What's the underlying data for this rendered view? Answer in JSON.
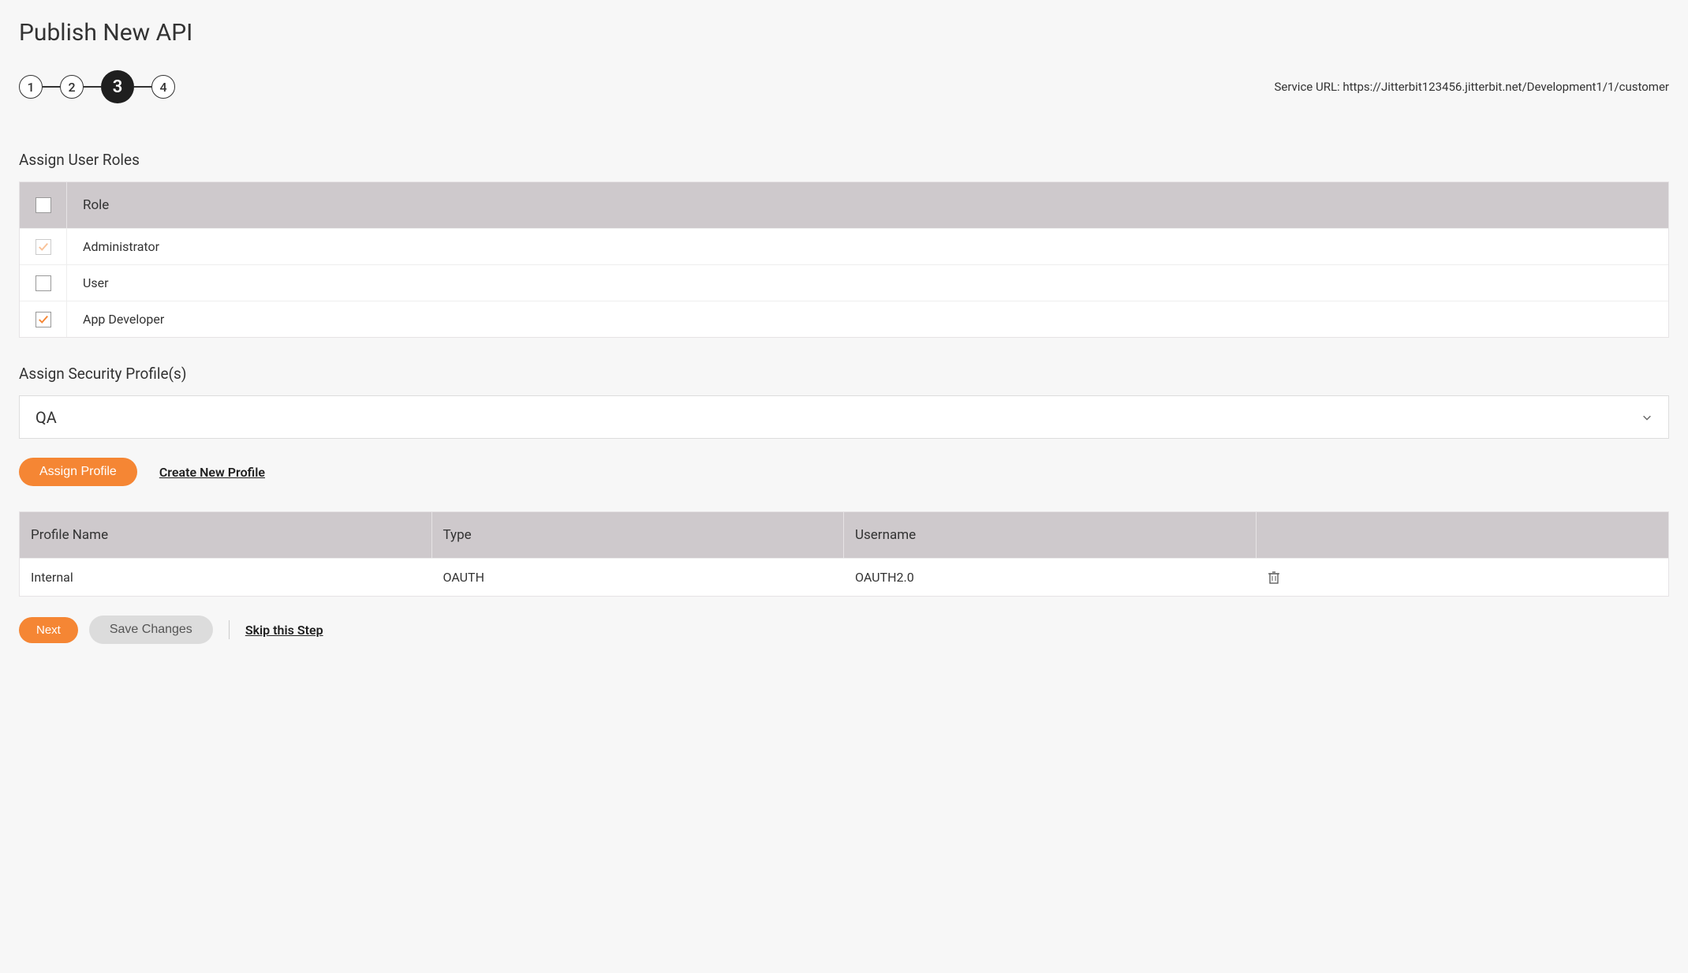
{
  "page_title": "Publish New API",
  "stepper": {
    "steps": [
      "1",
      "2",
      "3",
      "4"
    ],
    "active_index": 2
  },
  "service_url_label": "Service URL: ",
  "service_url_value": "https://Jitterbit123456.jitterbit.net/Development1/1/customer",
  "roles": {
    "heading": "Assign User Roles",
    "header_label": "Role",
    "items": [
      {
        "label": "Administrator",
        "checked": true,
        "disabled": true
      },
      {
        "label": "User",
        "checked": false,
        "disabled": false
      },
      {
        "label": "App Developer",
        "checked": true,
        "disabled": false
      }
    ]
  },
  "profiles": {
    "heading": "Assign Security Profile(s)",
    "select_value": "QA",
    "assign_button": "Assign Profile",
    "create_link": "Create New Profile",
    "columns": {
      "name": "Profile Name",
      "type": "Type",
      "username": "Username"
    },
    "rows": [
      {
        "name": "Internal",
        "type": "OAUTH",
        "username": "OAUTH2.0"
      }
    ]
  },
  "footer": {
    "next": "Next",
    "save": "Save Changes",
    "skip": "Skip this Step"
  }
}
